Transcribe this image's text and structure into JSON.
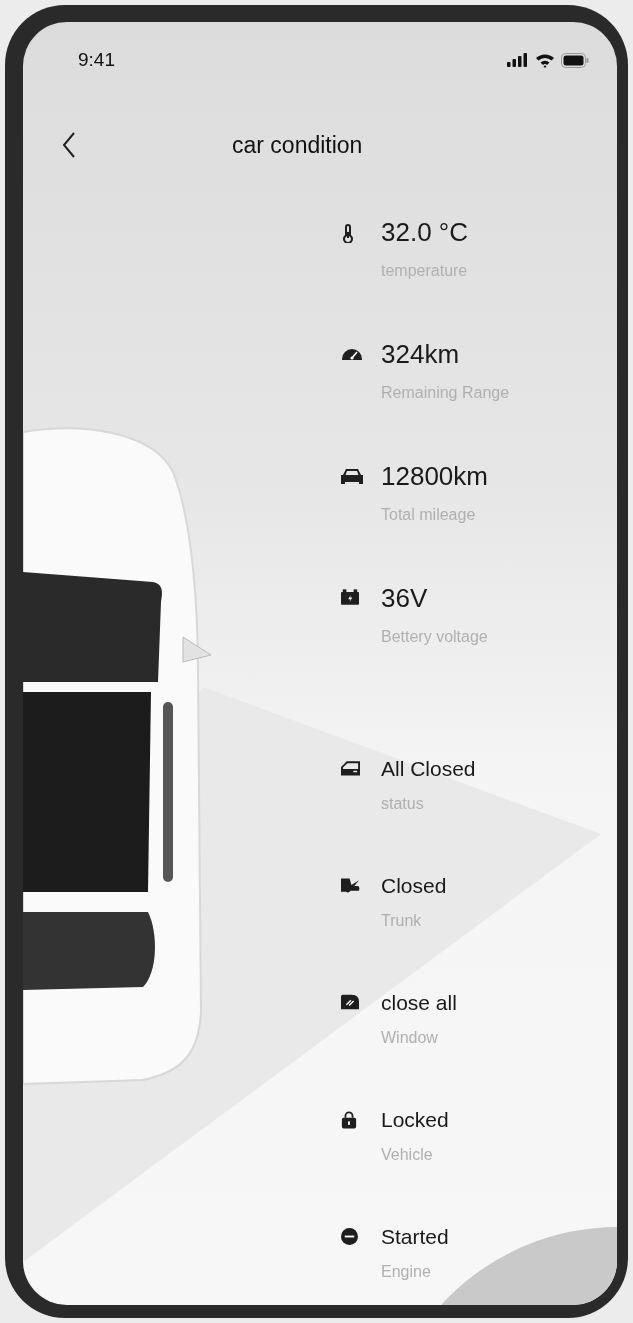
{
  "status_bar": {
    "time": "9:41"
  },
  "header": {
    "title": "car condition"
  },
  "readings": [
    {
      "value": "32.0 °C",
      "label": "temperature"
    },
    {
      "value": "324km",
      "label": "Remaining Range"
    },
    {
      "value": "12800km",
      "label": "Total mileage"
    },
    {
      "value": "36V",
      "label": "Bettery voltage"
    }
  ],
  "statuses": [
    {
      "value": "All Closed",
      "label": "status"
    },
    {
      "value": "Closed",
      "label": "Trunk"
    },
    {
      "value": "close all",
      "label": "Window"
    },
    {
      "value": "Locked",
      "label": "Vehicle"
    },
    {
      "value": "Started",
      "label": "Engine"
    }
  ]
}
